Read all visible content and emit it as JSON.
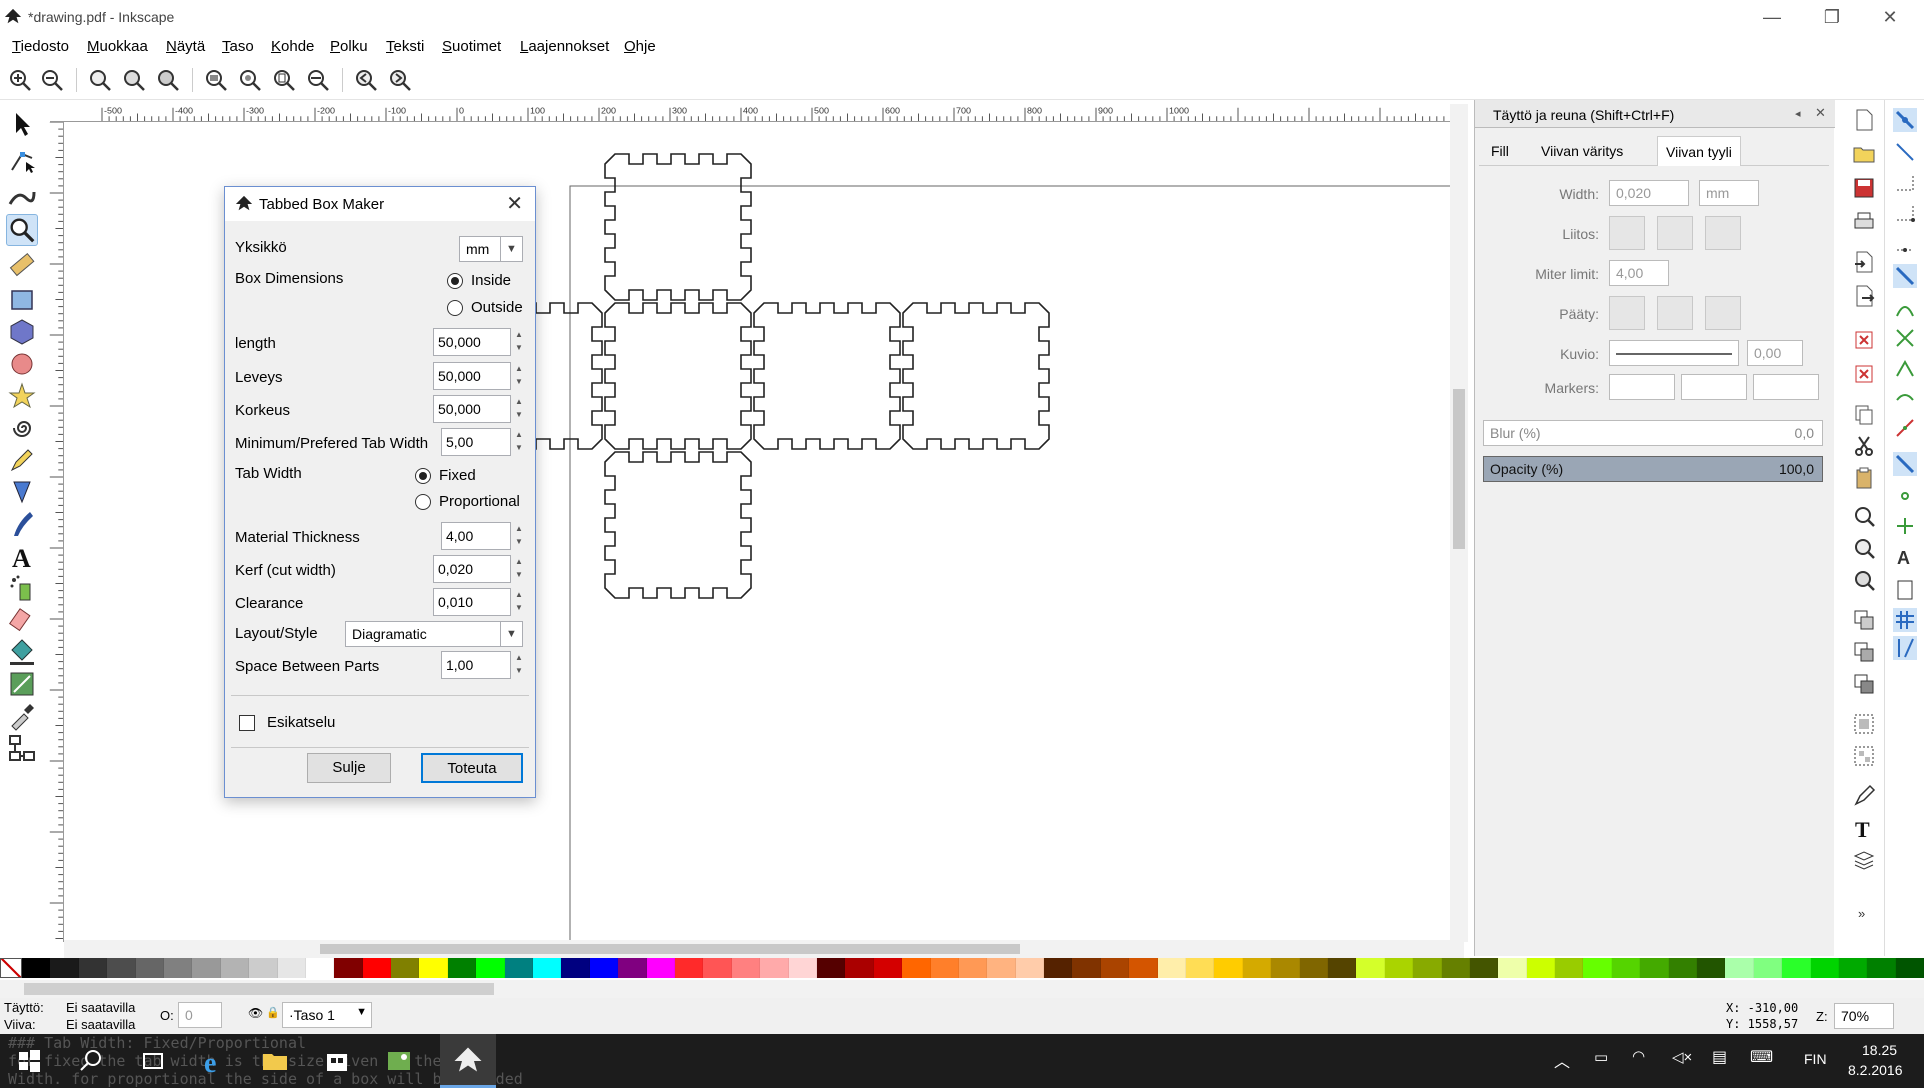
{
  "window": {
    "title": "*drawing.pdf - Inkscape",
    "minimize": "—",
    "restore": "❐",
    "close": "✕"
  },
  "menu": [
    "Tiedosto",
    "Muokkaa",
    "Näytä",
    "Taso",
    "Kohde",
    "Polku",
    "Teksti",
    "Suotimet",
    "Laajennokset",
    "Ohje"
  ],
  "ruler_labels": [
    "-500",
    "-400",
    "-300",
    "-200",
    "-100",
    "0",
    "100",
    "200",
    "300",
    "400",
    "500",
    "600",
    "700",
    "800",
    "900",
    "1000"
  ],
  "dialog": {
    "title": "Tabbed Box Maker",
    "close": "✕",
    "unit_label": "Yksikkö",
    "unit_value": "mm",
    "box_dimensions_label": "Box Dimensions",
    "inside_label": "Inside",
    "outside_label": "Outside",
    "length_label": "length",
    "length_value": "50,000",
    "width_label": "Leveys",
    "width_value": "50,000",
    "height_label": "Korkeus",
    "height_value": "50,000",
    "tab_min_label": "Minimum/Prefered Tab Width",
    "tab_min_value": "5,00",
    "tab_width_label": "Tab Width",
    "fixed_label": "Fixed",
    "proportional_label": "Proportional",
    "thickness_label": "Material Thickness",
    "thickness_value": "4,00",
    "kerf_label": "Kerf (cut width)",
    "kerf_value": "0,020",
    "clearance_label": "Clearance",
    "clearance_value": "0,010",
    "layout_label": "Layout/Style",
    "layout_value": "Diagramatic",
    "space_label": "Space Between Parts",
    "space_value": "1,00",
    "preview_label": "Esikatselu",
    "close_button": "Sulje",
    "apply_button": "Toteuta"
  },
  "dock": {
    "title": "Täyttö ja reuna (Shift+Ctrl+F)",
    "tab_fill": "Fill",
    "tab_stroke_paint": "Viivan väritys",
    "tab_stroke_style": "Viivan tyyli",
    "width_label": "Width:",
    "width_value": "0,020",
    "width_unit": "mm",
    "join_label": "Liitos:",
    "miter_label": "Miter limit:",
    "miter_value": "4,00",
    "cap_label": "Pääty:",
    "dash_label": "Kuvio:",
    "dash_value": "0,00",
    "markers_label": "Markers:",
    "blur_label": "Blur (%)",
    "blur_value": "0,0",
    "opacity_label": "Opacity (%)",
    "opacity_value": "100,0"
  },
  "status": {
    "fill_label": "Täyttö:",
    "fill_value": "Ei saatavilla",
    "stroke_label": "Viiva:",
    "stroke_value": "Ei saatavilla",
    "opacity_label": "O:",
    "opacity_value": "0",
    "layer": "·Taso 1",
    "x_readout": "X: -310,00",
    "y_readout": "Y: 1558,57",
    "zoom_label": "Z:",
    "zoom_value": "70%"
  },
  "taskbar": {
    "bg_line1": "### Tab Width: Fixed/Proportional",
    "bg_line2": "for fixed the tab width is the size given in the Tab",
    "bg_line3": "Width. for proportional the side of a box will be divided",
    "time": "18.25",
    "date": "8.2.2016",
    "lang": "FIN"
  },
  "palette": [
    "#000000",
    "#1a1a1a",
    "#333333",
    "#4d4d4d",
    "#666666",
    "#808080",
    "#999999",
    "#b3b3b3",
    "#cccccc",
    "#e6e6e6",
    "#ffffff",
    "#800000",
    "#ff0000",
    "#808000",
    "#ffff00",
    "#008000",
    "#00ff00",
    "#008080",
    "#00ffff",
    "#000080",
    "#0000ff",
    "#800080",
    "#ff00ff",
    "#ff2a2a",
    "#ff5555",
    "#ff8080",
    "#ffaaaa",
    "#ffd5d5",
    "#550000",
    "#aa0000",
    "#d40000",
    "#ff6600",
    "#ff7f2a",
    "#ff9955",
    "#ffb380",
    "#ffccaa",
    "#552200",
    "#803300",
    "#aa4400",
    "#d45500",
    "#ffeeaa",
    "#ffdd55",
    "#ffcc00",
    "#d4aa00",
    "#aa8800",
    "#806600",
    "#554400",
    "#d4ff2a",
    "#aad400",
    "#88aa00",
    "#668000",
    "#445500",
    "#eeffaa",
    "#ccff00",
    "#99cc00",
    "#66ff00",
    "#55d400",
    "#44aa00",
    "#338000",
    "#225500",
    "#aaffaa",
    "#80ff80",
    "#2aff2a",
    "#00d400",
    "#00aa00",
    "#008000",
    "#005500"
  ]
}
